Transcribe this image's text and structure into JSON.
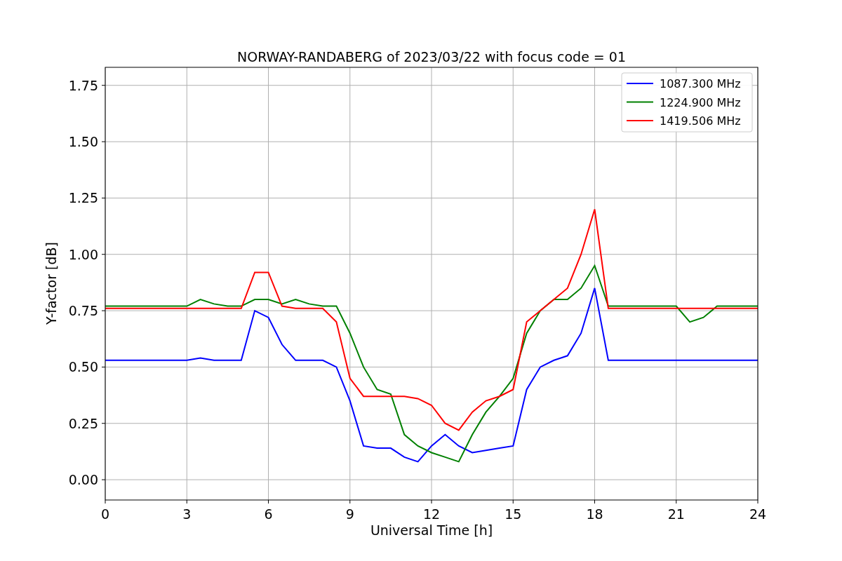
{
  "chart_data": {
    "type": "line",
    "title": "NORWAY-RANDABERG of 2023/03/22 with focus code = 01",
    "xlabel": "Universal Time [h]",
    "ylabel": "Y-factor [dB]",
    "x": [
      0,
      0.5,
      1,
      1.5,
      2,
      2.5,
      3,
      3.5,
      4,
      4.5,
      5,
      5.5,
      6,
      6.5,
      7,
      7.5,
      8,
      8.5,
      9,
      9.5,
      10,
      10.5,
      11,
      11.5,
      12,
      12.5,
      13,
      13.5,
      14,
      14.5,
      15,
      15.5,
      16,
      16.5,
      17,
      17.5,
      18,
      18.5,
      19,
      19.5,
      20,
      20.5,
      21,
      21.5,
      22,
      22.5,
      23,
      23.5,
      24
    ],
    "series": [
      {
        "name": "1087.300 MHz",
        "color": "#0000ff",
        "values": [
          0.53,
          0.53,
          0.53,
          0.53,
          0.53,
          0.53,
          0.53,
          0.54,
          0.53,
          0.53,
          0.53,
          0.75,
          0.72,
          0.6,
          0.53,
          0.53,
          0.53,
          0.5,
          0.35,
          0.15,
          0.14,
          0.14,
          0.1,
          0.08,
          0.15,
          0.2,
          0.15,
          0.12,
          0.13,
          0.14,
          0.15,
          0.4,
          0.5,
          0.53,
          0.55,
          0.65,
          0.85,
          0.53,
          0.53,
          0.53,
          0.53,
          0.53,
          0.53,
          0.53,
          0.53,
          0.53,
          0.53,
          0.53,
          0.53
        ]
      },
      {
        "name": "1224.900 MHz",
        "color": "#008000",
        "values": [
          0.77,
          0.77,
          0.77,
          0.77,
          0.77,
          0.77,
          0.77,
          0.8,
          0.78,
          0.77,
          0.77,
          0.8,
          0.8,
          0.78,
          0.8,
          0.78,
          0.77,
          0.77,
          0.65,
          0.5,
          0.4,
          0.38,
          0.2,
          0.15,
          0.12,
          0.1,
          0.08,
          0.2,
          0.3,
          0.37,
          0.45,
          0.65,
          0.75,
          0.8,
          0.8,
          0.85,
          0.95,
          0.77,
          0.77,
          0.77,
          0.77,
          0.77,
          0.77,
          0.7,
          0.72,
          0.77,
          0.77,
          0.77,
          0.77
        ]
      },
      {
        "name": "1419.506 MHz",
        "color": "#ff0000",
        "values": [
          0.76,
          0.76,
          0.76,
          0.76,
          0.76,
          0.76,
          0.76,
          0.76,
          0.76,
          0.76,
          0.76,
          0.92,
          0.92,
          0.77,
          0.76,
          0.76,
          0.76,
          0.7,
          0.45,
          0.37,
          0.37,
          0.37,
          0.37,
          0.36,
          0.33,
          0.25,
          0.22,
          0.3,
          0.35,
          0.37,
          0.4,
          0.7,
          0.75,
          0.8,
          0.85,
          1.0,
          1.2,
          0.76,
          0.76,
          0.76,
          0.76,
          0.76,
          0.76,
          0.76,
          0.76,
          0.76,
          0.76,
          0.76,
          0.76
        ]
      }
    ],
    "grid": true,
    "legend": true,
    "xlim": [
      0,
      24
    ],
    "ylim": [
      -0.09,
      1.83
    ],
    "xticks": [
      0,
      3,
      6,
      9,
      12,
      15,
      18,
      21,
      24
    ],
    "yticks": [
      {
        "value": 0,
        "label": "0.00"
      },
      {
        "value": 0.25,
        "label": "0.25"
      },
      {
        "value": 0.5,
        "label": "0.50"
      },
      {
        "value": 0.75,
        "label": "0.75"
      },
      {
        "value": 1,
        "label": "1.00"
      },
      {
        "value": 1.25,
        "label": "1.25"
      },
      {
        "value": 1.5,
        "label": "1.50"
      },
      {
        "value": 1.75,
        "label": "1.75"
      }
    ]
  }
}
